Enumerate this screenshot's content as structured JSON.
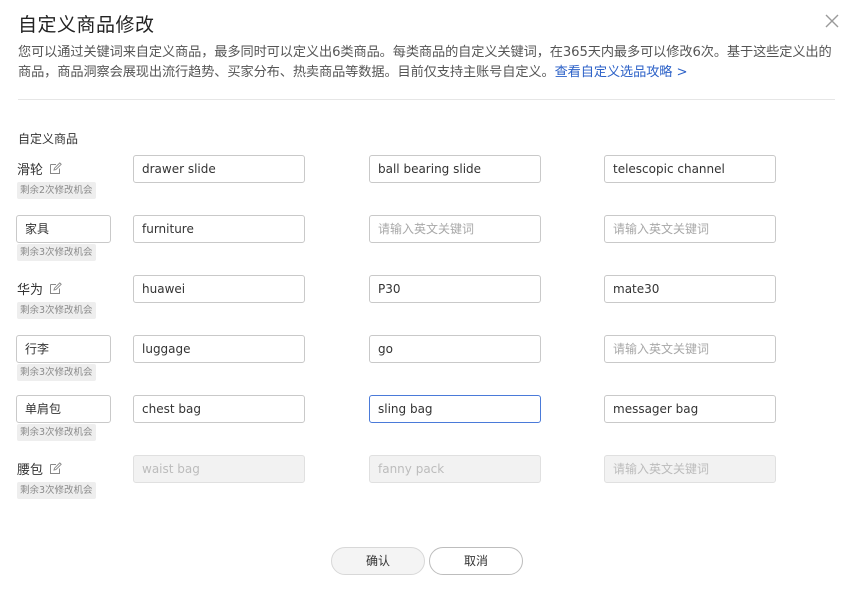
{
  "dialog": {
    "title": "自定义商品修改",
    "description": "您可以通过关键词来自定义商品，最多同时可以定义出6类商品。每类商品的自定义关键词，在365天内最多可以修改6次。基于这些定义出的商品，商品洞察会展现出流行趋势、买家分布、热卖商品等数据。目前仅支持主账号自定义。",
    "guide_link": "查看自定义选品攻略 >",
    "section_label": "自定义商品"
  },
  "placeholder": "请输入英文关键词",
  "rows": [
    {
      "name": "滑轮",
      "badge": "剩余2次修改机会",
      "kw1": "drawer slide",
      "kw2": "ball bearing slide",
      "kw3": "telescopic channel"
    },
    {
      "name": "家具",
      "badge": "剩余3次修改机会",
      "kw1": "furniture",
      "kw2": "",
      "kw3": ""
    },
    {
      "name": "华为",
      "badge": "剩余3次修改机会",
      "kw1": "huawei",
      "kw2": "P30",
      "kw3": "mate30"
    },
    {
      "name": "行李",
      "badge": "剩余3次修改机会",
      "kw1": "luggage",
      "kw2": "go",
      "kw3": ""
    },
    {
      "name": "单肩包",
      "badge": "剩余3次修改机会",
      "kw1": "chest bag",
      "kw2": "sling bag",
      "kw3": "messager bag"
    },
    {
      "name": "腰包",
      "badge": "剩余3次修改机会",
      "kw1": "waist bag",
      "kw2": "fanny pack",
      "kw3": ""
    }
  ],
  "buttons": {
    "confirm": "确认",
    "cancel": "取消"
  },
  "colors": {
    "link": "#2d62c8",
    "active_border": "#4a7ad9"
  }
}
